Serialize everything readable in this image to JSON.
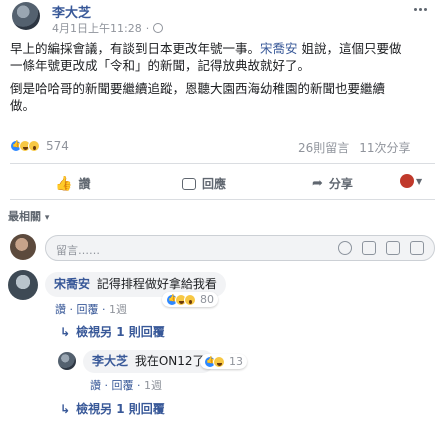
{
  "post": {
    "author": "李大芝",
    "timestamp": "4月1日上午11:28",
    "audience_sep": "·",
    "text_line1_pre": "早上的編採會議，有談到日本更改年號一事。",
    "text_mention": "宋喬安",
    "text_line1_post": " 姐說，這個只要做",
    "text_line2": "一條年號更改成「令和」的新聞，記得放典故就好了。",
    "text_line3": "倒是哈哈哥的新聞要繼續追蹤，恩聽大園西海幼稚園的新聞也要繼續",
    "text_line4": "做。",
    "reactions_count": "574",
    "comments_count": "26則留言",
    "shares_count": "11次分享"
  },
  "actions": {
    "like": "讚",
    "comment": "回應",
    "share": "分享"
  },
  "sort": {
    "label": "最相關",
    "caret": "▾"
  },
  "composer": {
    "placeholder": "留言……"
  },
  "comments": [
    {
      "author": "宋喬安",
      "text": "記得排程做好拿給我看",
      "like": "讚",
      "reply": "回覆",
      "time": "1週",
      "reaction_count": "80",
      "view_replies": "檢視另 1 則回覆",
      "reply_item": {
        "author": "李大芝",
        "text": "我在ON12了",
        "like": "讚",
        "reply": "回覆",
        "time": "1週",
        "reaction_count": "13"
      }
    }
  ],
  "bottom_view_replies": "檢視另 1 則回覆",
  "colors": {
    "link": "#385898",
    "meta": "#90949c",
    "like_blue": "#2d88ff",
    "haha_yellow": "#f7c844"
  }
}
